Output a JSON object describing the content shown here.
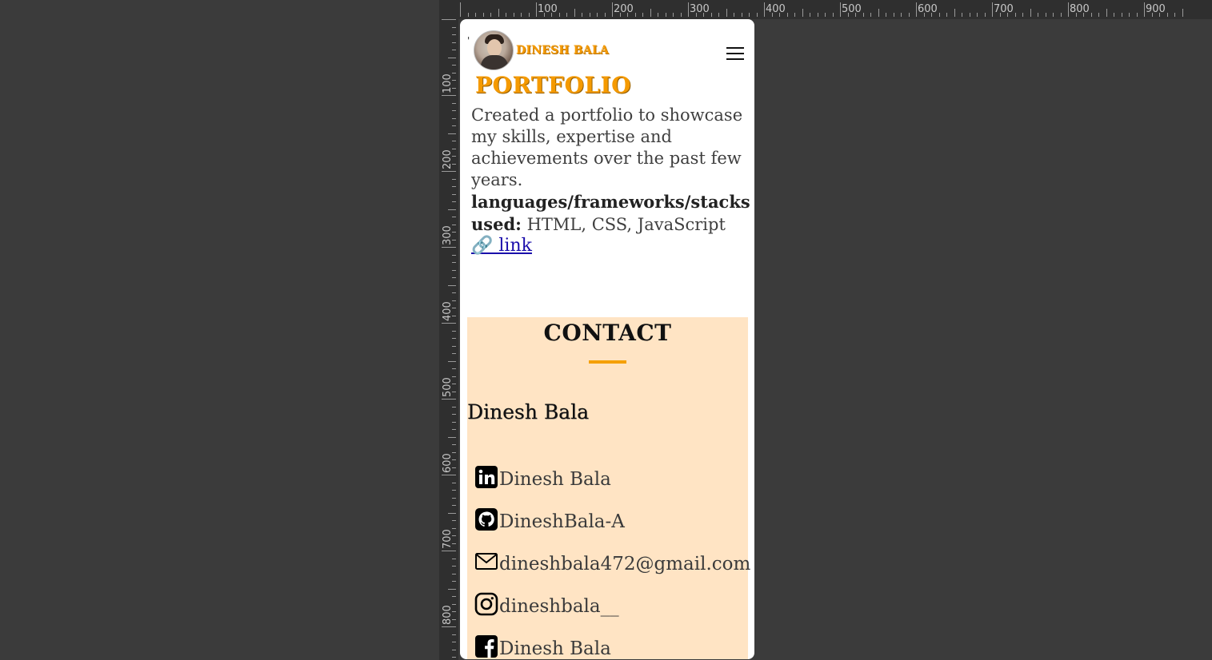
{
  "ruler": {
    "top_labels": [
      "100",
      "200",
      "300",
      "400",
      "500",
      "600",
      "700",
      "800",
      "900"
    ],
    "left_labels": [
      "100",
      "200",
      "300",
      "400",
      "500",
      "600",
      "700",
      "800"
    ]
  },
  "header": {
    "brand": "DINESH BALA",
    "menu_icon": "hamburger-icon",
    "avatar_icon": "profile-avatar"
  },
  "portfolio": {
    "title": "PORTFOLIO",
    "description": "Created a portfolio to showcase my skills, expertise and achievements over the past few years.",
    "stack_label": "languages/frameworks/stacks used:",
    "stack_value": "HTML, CSS, JavaScript",
    "link_label": "🔗 link"
  },
  "contact": {
    "title": "CONTACT",
    "name": "Dinesh Bala",
    "items": [
      {
        "icon": "linkedin-icon",
        "label": "Dinesh Bala"
      },
      {
        "icon": "github-icon",
        "label": "DineshBala-A"
      },
      {
        "icon": "mail-icon",
        "label": "dineshbala472@gmail.com"
      },
      {
        "icon": "instagram-icon",
        "label": "dineshbala__"
      },
      {
        "icon": "facebook-icon",
        "label": "Dinesh Bala"
      }
    ]
  },
  "colors": {
    "accent": "#f59a00",
    "contact_bg": "#ffe4c4",
    "page_bg": "#3b3b3b"
  }
}
